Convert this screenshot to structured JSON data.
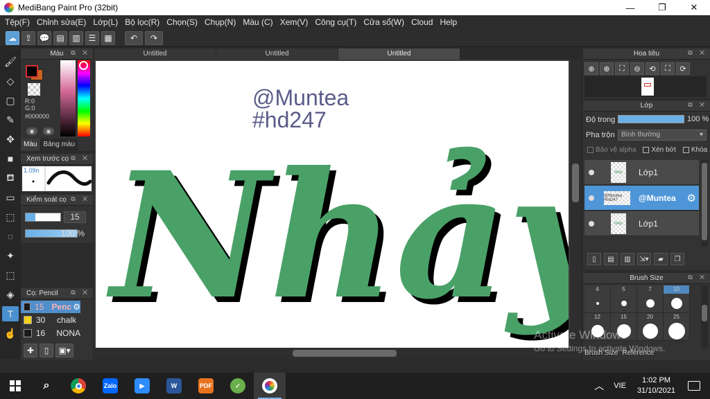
{
  "window": {
    "title": "MediBang Paint Pro (32bit)",
    "minimize": "—",
    "restore": "❐",
    "close": "✕"
  },
  "menu": [
    "Tệp(F)",
    "Chỉnh sửa(E)",
    "Lớp(L)",
    "Bộ lọc(R)",
    "Chọn(S)",
    "Chụp(N)",
    "Màu (C)",
    "Xem(V)",
    "Công cụ(T)",
    "Cửa sổ(W)",
    "Cloud",
    "Help"
  ],
  "color_panel": {
    "title": "Màu",
    "r": "R:0",
    "g": "G:0",
    "hex": "#000000",
    "tabs": [
      "Màu",
      "Bảng màu"
    ],
    "fg_color": "#000000",
    "bg_color": "#c8641e"
  },
  "brush_preview": {
    "title": "Xem trước cọ",
    "size": "1.09n"
  },
  "brush_control": {
    "title": "Kiểm soát cọ",
    "size_value": "15",
    "opacity_value": "100 %"
  },
  "brush_list": {
    "title": "Cọ: Pencil",
    "items": [
      {
        "size": "15",
        "name": "Penc",
        "color": "#1a1a1a"
      },
      {
        "size": "30",
        "name": "chalk",
        "color": "#f2d21a"
      },
      {
        "size": "16",
        "name": "NONA",
        "color": "#1a1a1a"
      }
    ]
  },
  "documents": {
    "tabs": [
      "Untitled",
      "Untitled",
      "Untitled"
    ]
  },
  "artwork": {
    "handle": "@Muntea",
    "tag": "#hd247",
    "word": "Nhảy",
    "handle_color": "#5b5b8a",
    "letter_color": "#4aa167"
  },
  "navigator": {
    "title": "Hoa tiêu"
  },
  "layers": {
    "title": "Lớp",
    "opacity_label": "Độ trong",
    "opacity_value": "100 %",
    "blend_label": "Pha trộn",
    "blend_value": "Bình thường",
    "protect_alpha": "Bảo vệ alpha",
    "clipping": "Xén bớt",
    "lock": "Khóa",
    "items": [
      {
        "name": "Lớp1",
        "thumb_text": "Nhảy"
      },
      {
        "name": "@Muntea",
        "thumb_text": "@Muntea #hd247"
      },
      {
        "name": "Lớp1",
        "thumb_text": "Nhảy"
      }
    ]
  },
  "brush_size": {
    "title": "Brush Size",
    "sizes": [
      "4",
      "5",
      "7",
      "10",
      "12",
      "15",
      "20",
      "25"
    ],
    "tabs": [
      "Brush Size",
      "Reference"
    ]
  },
  "watermark": {
    "line1": "Activate Windows",
    "line2": "Go to Settings to activate Windows."
  },
  "taskbar": {
    "lang": "VIE",
    "time": "1:02 PM",
    "date": "31/10/2021",
    "apps": [
      "zalo",
      "zoom",
      "word",
      "pdf",
      "clip",
      "medibang"
    ]
  }
}
